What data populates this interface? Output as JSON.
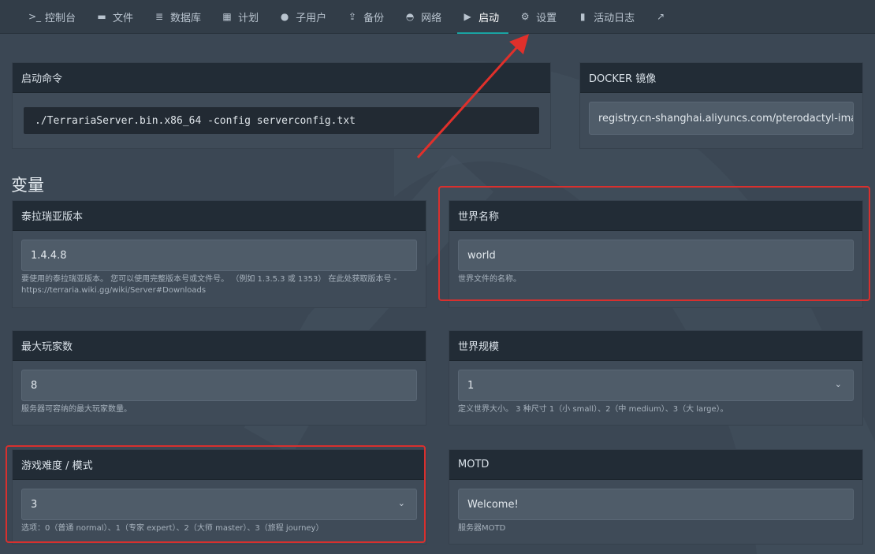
{
  "nav": {
    "items": [
      {
        "icon": "terminal-icon",
        "glyph": ">_",
        "label": "控制台"
      },
      {
        "icon": "folder-icon",
        "glyph": "▬",
        "label": "文件"
      },
      {
        "icon": "database-icon",
        "glyph": "≣",
        "label": "数据库"
      },
      {
        "icon": "calendar-icon",
        "glyph": "▦",
        "label": "计划"
      },
      {
        "icon": "users-icon",
        "glyph": "●",
        "label": "子用户"
      },
      {
        "icon": "upload-icon",
        "glyph": "⇪",
        "label": "备份"
      },
      {
        "icon": "network-icon",
        "glyph": "◓",
        "label": "网络"
      },
      {
        "icon": "play-circle-icon",
        "glyph": "▶",
        "label": "启动"
      },
      {
        "icon": "gears-icon",
        "glyph": "⚙",
        "label": "设置"
      },
      {
        "icon": "book-icon",
        "glyph": "▮",
        "label": "活动日志"
      },
      {
        "icon": "external-link-icon",
        "glyph": "↗",
        "label": ""
      }
    ],
    "active": "启动"
  },
  "startup": {
    "title": "启动命令",
    "command": "./TerrariaServer.bin.x86_64 -config serverconfig.txt"
  },
  "docker": {
    "title": "DOCKER 镜像",
    "image": "registry.cn-shanghai.aliyuncs.com/pterodactyl-image"
  },
  "variables_title": "变量",
  "variables": {
    "version": {
      "title": "泰拉瑞亚版本",
      "value": "1.4.4.8",
      "help": "要使用的泰拉瑞亚版本。 您可以使用完整版本号或文件号。 （例如 1.3.5.3 或 1353） 在此处获取版本号 - https://terraria.wiki.gg/wiki/Server#Downloads"
    },
    "world_name": {
      "title": "世界名称",
      "value": "world",
      "help": "世界文件的名称。"
    },
    "max_players": {
      "title": "最大玩家数",
      "value": "8",
      "help": "服务器可容纳的最大玩家数量。"
    },
    "world_size": {
      "title": "世界规模",
      "value": "1",
      "help": "定义世界大小。 3 种尺寸 1（小 small）、2（中 medium）、3（大 large）。"
    },
    "difficulty": {
      "title": "游戏难度 / 模式",
      "value": "3",
      "help": "选项：0（普通 normal）、1（专家 expert）、2（大师 master）、3（旅程 journey）"
    },
    "motd": {
      "title": "MOTD",
      "value": "Welcome!",
      "help": "服务器MOTD"
    }
  },
  "colors": {
    "background": "#3b4754",
    "panel_header": "#222c36",
    "accent": "#1aa3a3",
    "annotation_red": "#d8302e"
  }
}
